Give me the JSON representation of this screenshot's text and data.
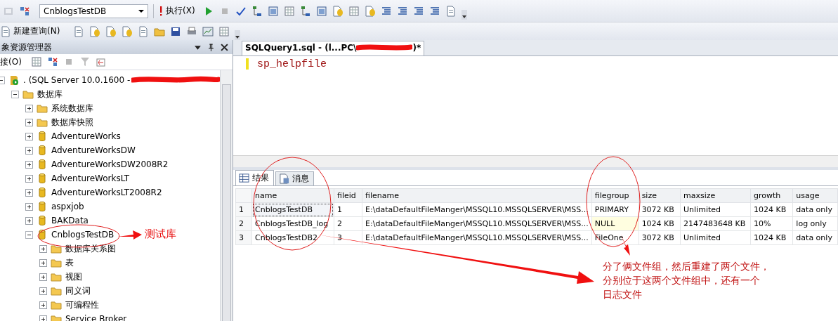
{
  "toolbar": {
    "database": "CnblogsTestDB",
    "execute": "执行(X)",
    "new_query": "新建查询(N)"
  },
  "explorer": {
    "title": "象资源管理器",
    "connect": "接(O)",
    "tree": [
      {
        "label": ". (SQL Server 10.0.1600 -",
        "kind": "server",
        "expanded": true,
        "redacted": true,
        "children": [
          {
            "label": "数据库",
            "kind": "folder",
            "expanded": true,
            "children": [
              {
                "label": "系统数据库",
                "kind": "folder",
                "expanded": false
              },
              {
                "label": "数据库快照",
                "kind": "folder",
                "expanded": false
              },
              {
                "label": "AdventureWorks",
                "kind": "database",
                "expanded": false
              },
              {
                "label": "AdventureWorksDW",
                "kind": "database",
                "expanded": false
              },
              {
                "label": "AdventureWorksDW2008R2",
                "kind": "database",
                "expanded": false
              },
              {
                "label": "AdventureWorksLT",
                "kind": "database",
                "expanded": false
              },
              {
                "label": "AdventureWorksLT2008R2",
                "kind": "database",
                "expanded": false
              },
              {
                "label": "aspxjob",
                "kind": "database",
                "expanded": false
              },
              {
                "label": "BAKData",
                "kind": "database",
                "expanded": false
              },
              {
                "label": "CnblogsTestDB",
                "kind": "database",
                "expanded": true,
                "children": [
                  {
                    "label": "数据库关系图",
                    "kind": "folder",
                    "expanded": false
                  },
                  {
                    "label": "表",
                    "kind": "folder",
                    "expanded": false
                  },
                  {
                    "label": "视图",
                    "kind": "folder",
                    "expanded": false
                  },
                  {
                    "label": "同义词",
                    "kind": "folder",
                    "expanded": false
                  },
                  {
                    "label": "可编程性",
                    "kind": "folder",
                    "expanded": false
                  },
                  {
                    "label": "Service Broker",
                    "kind": "folder",
                    "expanded": false
                  }
                ]
              }
            ]
          }
        ]
      }
    ]
  },
  "editor": {
    "tab": "SQLQuery1.sql - (l...PC\\",
    "tab_suffix": ")*",
    "code": "sp_helpfile"
  },
  "results": {
    "tabs": [
      {
        "label": "结果",
        "kind": "grid",
        "selected": true
      },
      {
        "label": "消息",
        "kind": "messages",
        "selected": false
      }
    ],
    "columns": [
      "name",
      "fileid",
      "filename",
      "filegroup",
      "size",
      "maxsize",
      "growth",
      "usage"
    ],
    "rows": [
      {
        "number": "1",
        "focused": true,
        "filegroup_null": false,
        "cells": [
          "CnblogsTestDB",
          "1",
          "E:\\dataDefaultFileManger\\MSSQL10.MSSQLSERVER\\MSS...",
          "PRIMARY",
          "3072 KB",
          "Unlimited",
          "1024 KB",
          "data only"
        ]
      },
      {
        "number": "2",
        "focused": false,
        "filegroup_null": true,
        "cells": [
          "CnblogsTestDB_log",
          "2",
          "E:\\dataDefaultFileManger\\MSSQL10.MSSQLSERVER\\MSS...",
          "NULL",
          "1024 KB",
          "2147483648 KB",
          "10%",
          "log only"
        ]
      },
      {
        "number": "3",
        "focused": false,
        "filegroup_null": false,
        "cells": [
          "CnblogsTestDB2",
          "3",
          "E:\\dataDefaultFileManger\\MSSQL10.MSSQLSERVER\\MSS...",
          "FileOne",
          "3072 KB",
          "Unlimited",
          "1024 KB",
          "data only"
        ]
      }
    ]
  },
  "annotations": {
    "label": "测试库",
    "note": [
      "分了俩文件组，然后重建了两个文件，",
      "分别位于这两个文件组中，还有一个",
      "日志文件"
    ]
  }
}
